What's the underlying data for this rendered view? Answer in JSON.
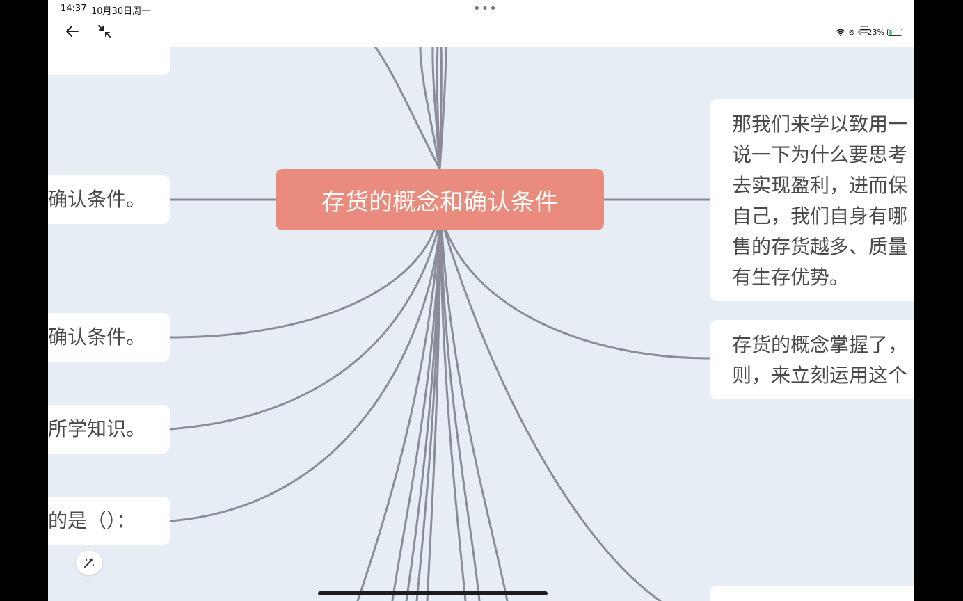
{
  "status_bar": {
    "time": "14:37",
    "date": "10月30日周一",
    "battery_percent": "23%"
  },
  "toolbar": {
    "back_icon": "arrow-left-icon",
    "collapse_icon": "collapse-arrows-icon",
    "more_icon": "more-dots-icon",
    "outline_icon": "list-icon"
  },
  "mindmap": {
    "center_topic": "存货的概念和确认条件",
    "left_nodes": [
      "确认条件。",
      "确认条件。",
      "所学知识。",
      "的是（）："
    ],
    "right_nodes": [
      {
        "lines": [
          "那我们来学以致用一",
          "说一下为什么要思考",
          "去实现盈利，进而保",
          "自己，我们自身有哪",
          "售的存货越多、质量",
          "有生存优势。"
        ]
      },
      {
        "lines": [
          "存货的概念掌握了，",
          "则，来立刻运用这个"
        ]
      }
    ]
  },
  "colors": {
    "canvas_bg": "#e6edf5",
    "center_node": "#e98b7d",
    "connector": "#8a8c98",
    "node_bg": "#ffffff"
  },
  "magic_button_icon": "magic-wand-icon"
}
